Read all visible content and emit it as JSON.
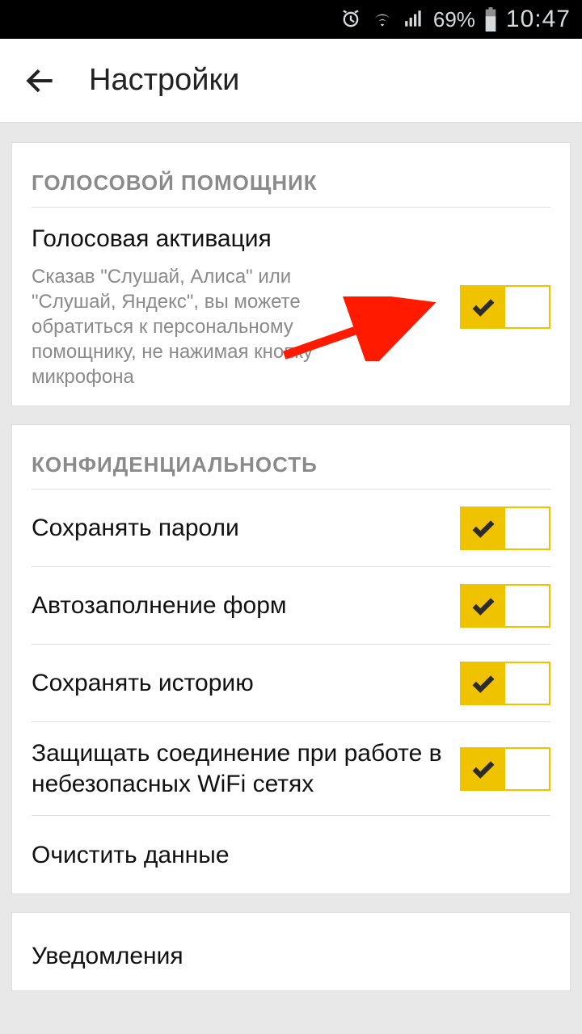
{
  "status": {
    "battery_pct": "69%",
    "time": "10:47"
  },
  "header": {
    "title": "Настройки"
  },
  "sections": {
    "voice": {
      "header": "ГОЛОСОВОЙ ПОМОЩНИК",
      "activation": {
        "title": "Голосовая активация",
        "desc": "Сказав \"Слушай, Алиса\" или \"Слушай, Яндекс\", вы можете обратиться к персональному помощнику, не нажимая кнопку микрофона"
      }
    },
    "privacy": {
      "header": "КОНФИДЕНЦИАЛЬНОСТЬ",
      "save_passwords": "Сохранять пароли",
      "autofill": "Автозаполнение форм",
      "save_history": "Сохранять историю",
      "protect_wifi": "Защищать соединение при работе в небезопасных WiFi сетях",
      "clear_data": "Очистить данные"
    },
    "notifications": {
      "title": "Уведомления"
    }
  }
}
